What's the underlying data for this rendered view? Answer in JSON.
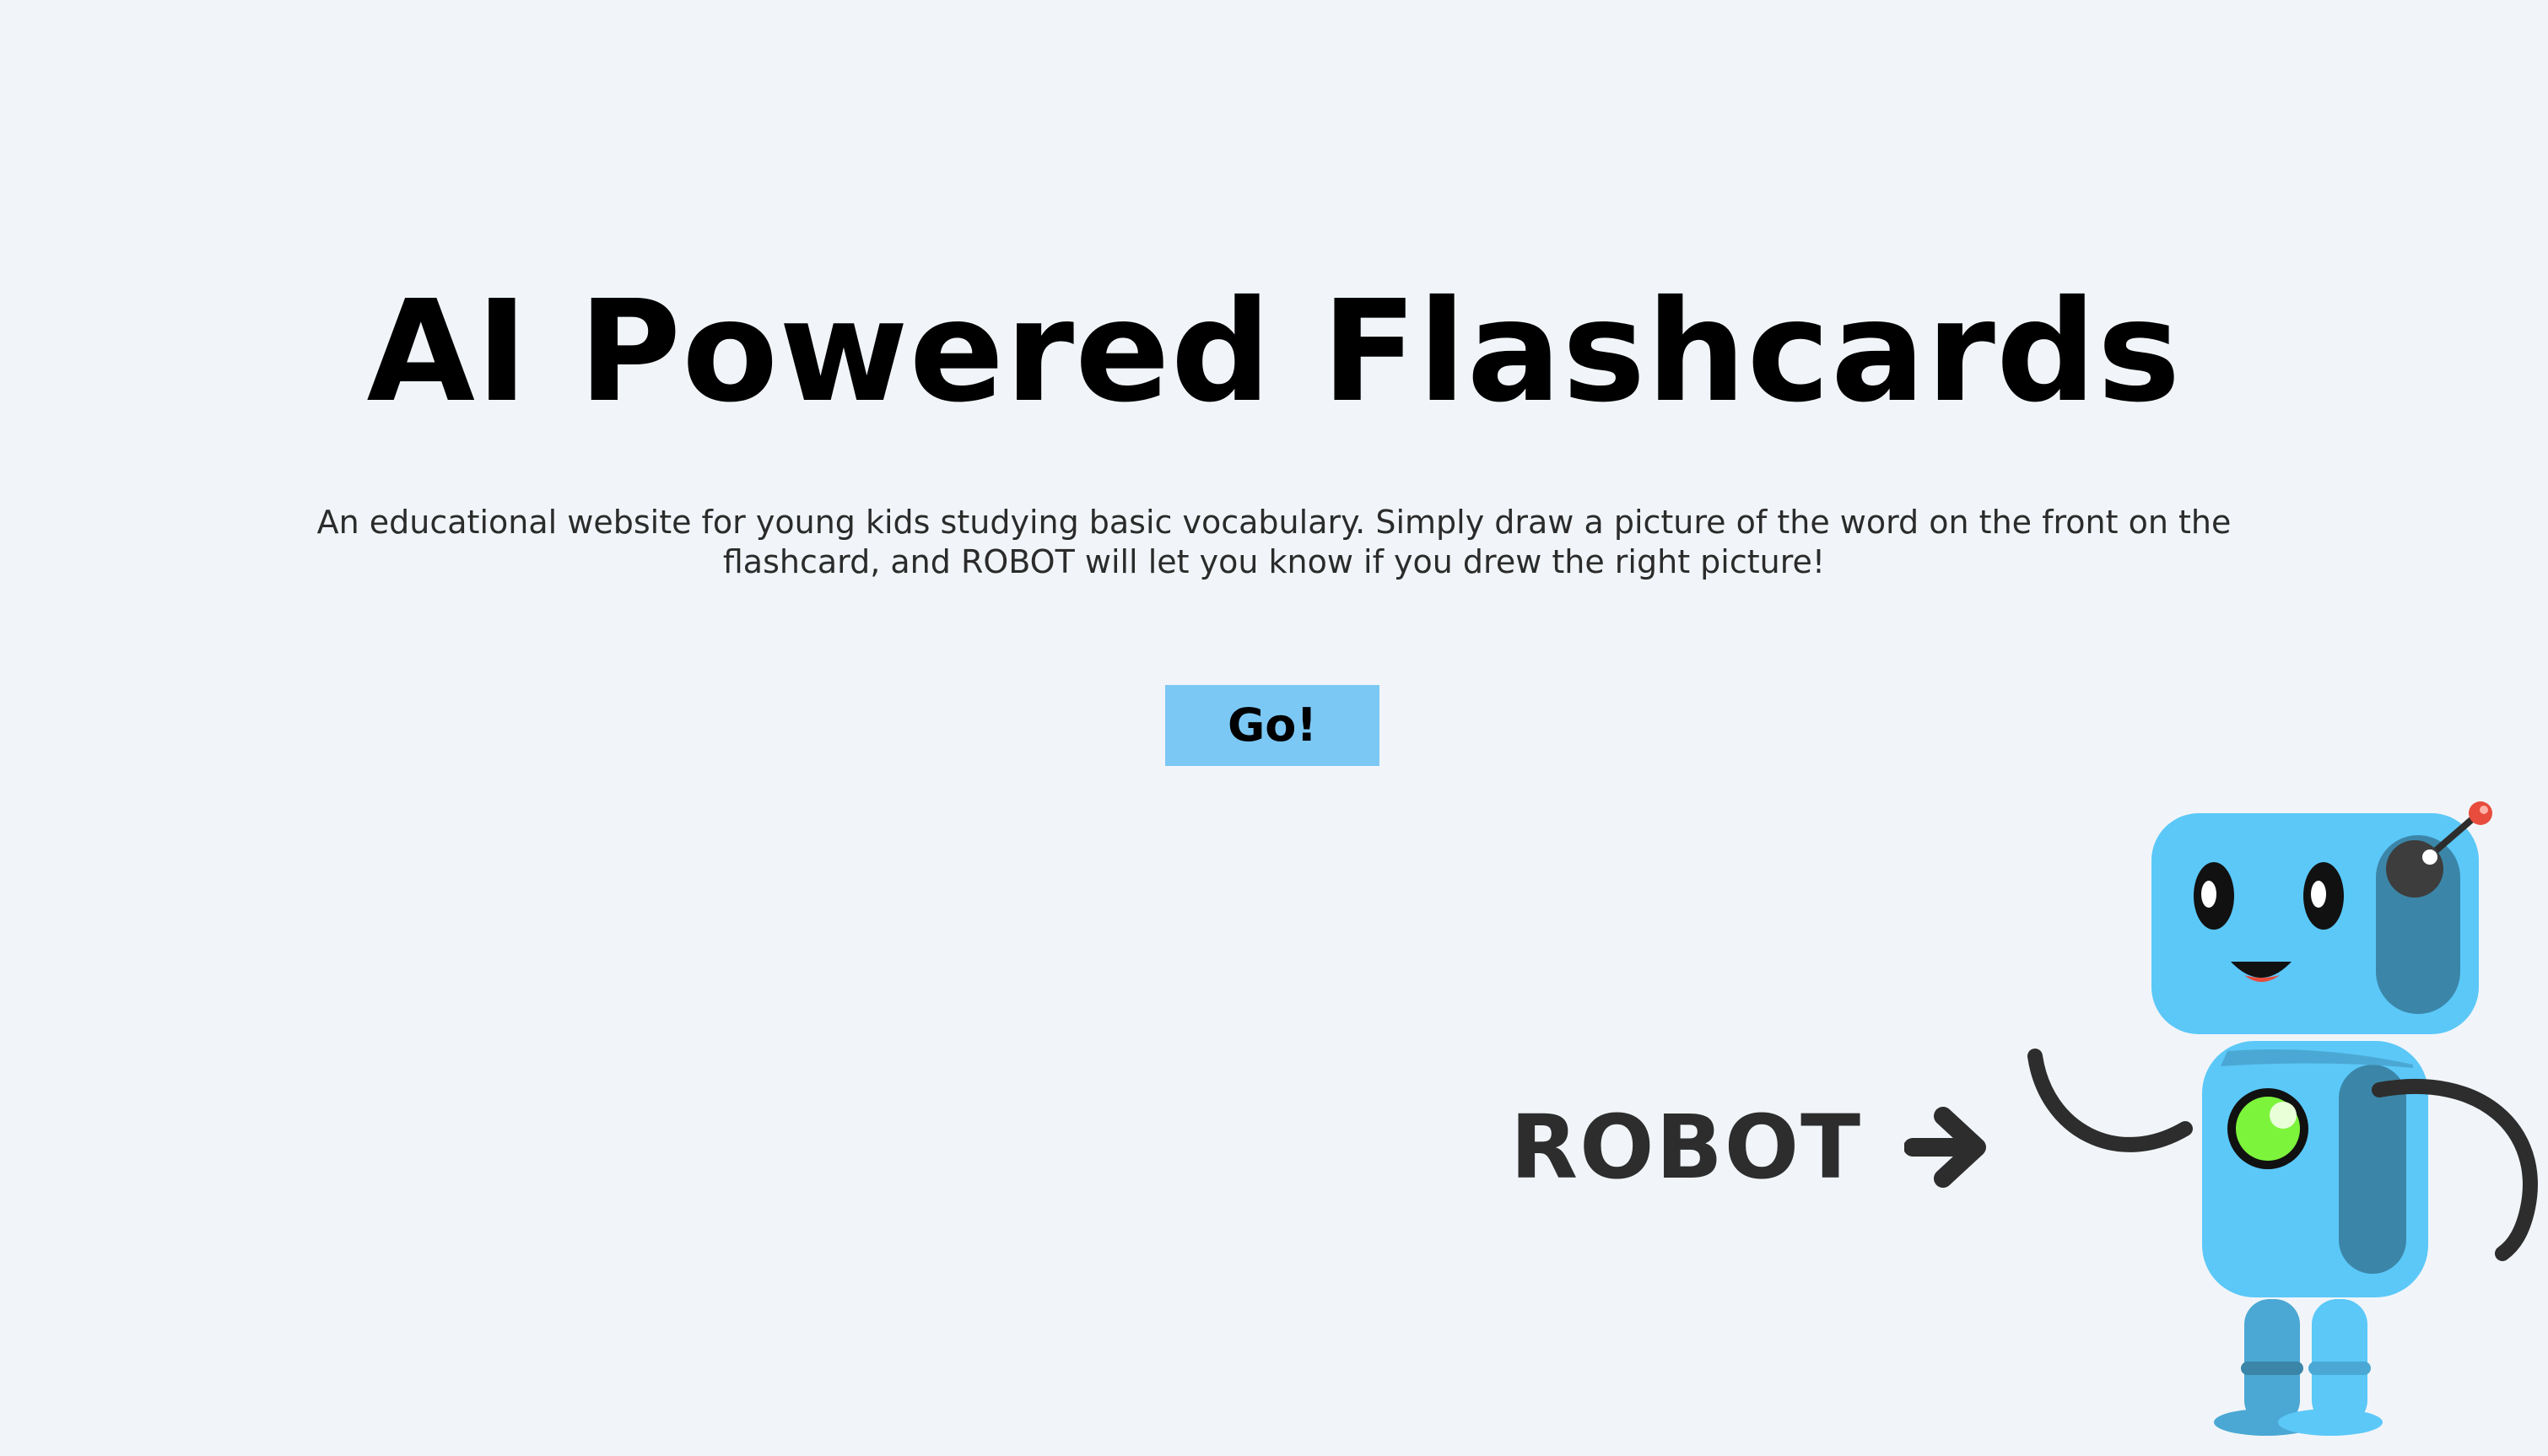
{
  "hero": {
    "title": "AI Powered Flashcards",
    "description": "An educational website for young kids studying basic vocabulary. Simply draw a picture of the word on the front on the flashcard, and ROBOT will let you know if you drew the right picture!"
  },
  "actions": {
    "go_label": "Go!"
  },
  "mascot": {
    "label": "ROBOT",
    "arrow_icon": "arrow-right-icon",
    "illustration_icon": "robot-illustration"
  },
  "colors": {
    "background": "#f1f5f9",
    "button": "#7cc8f5",
    "robot_body": "#5bc8f8",
    "robot_shade": "#3b86a8",
    "robot_chest_light": "#7cf43c",
    "antenna_tip": "#e74c3c",
    "text": "#000000"
  }
}
